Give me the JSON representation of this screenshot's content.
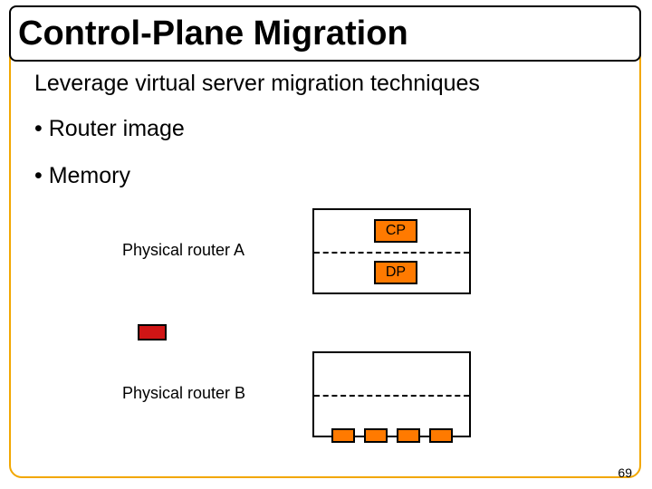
{
  "title": "Control-Plane Migration",
  "subtitle": "Leverage virtual server migration techniques",
  "bullets": [
    "• Router image",
    "• Memory"
  ],
  "routerA": {
    "label": "Physical router A",
    "cp_label": "CP",
    "dp_label": "DP"
  },
  "routerB": {
    "label": "Physical router B",
    "port_count": 4
  },
  "legend": {
    "red_box": true
  },
  "page_number": "69",
  "accent_color": "#ff7a00",
  "frame_color": "#f2a700",
  "alert_color": "#d11515"
}
